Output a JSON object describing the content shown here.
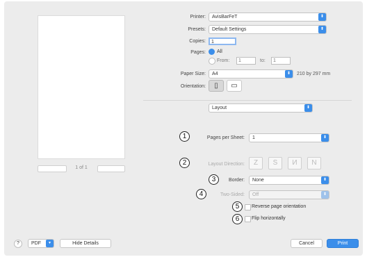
{
  "preview": {
    "page_range_text": "1 of 1"
  },
  "printer": {
    "label": "Printer:",
    "value": "AvisBarFeT"
  },
  "presets": {
    "label": "Presets:",
    "value": "Default Settings"
  },
  "copies": {
    "label": "Copies:",
    "value": "1"
  },
  "pages": {
    "label": "Pages:",
    "all_label": "All",
    "from_label": "From:",
    "from_value": "1",
    "to_label": "to:",
    "to_value": "1"
  },
  "paper_size": {
    "label": "Paper Size:",
    "value": "A4",
    "dimensions": "210 by 297 mm"
  },
  "orientation": {
    "label": "Orientation:"
  },
  "section": {
    "value": "Layout"
  },
  "layout": {
    "pages_per_sheet_label": "Pages per Sheet:",
    "pages_per_sheet_value": "1",
    "layout_direction_label": "Layout Direction:",
    "border_label": "Border:",
    "border_value": "None",
    "two_sided_label": "Two-Sided:",
    "two_sided_value": "Off",
    "reverse_label": "Reverse page orientation",
    "flip_label": "Flip horizontally"
  },
  "callouts": [
    "1",
    "2",
    "3",
    "4",
    "5",
    "6"
  ],
  "bottom": {
    "help": "?",
    "pdf_label": "PDF",
    "hide_details": "Hide Details",
    "cancel": "Cancel",
    "print": "Print"
  },
  "colors": {
    "accent": "#3b8eea",
    "dialog_bg": "#ececec"
  }
}
